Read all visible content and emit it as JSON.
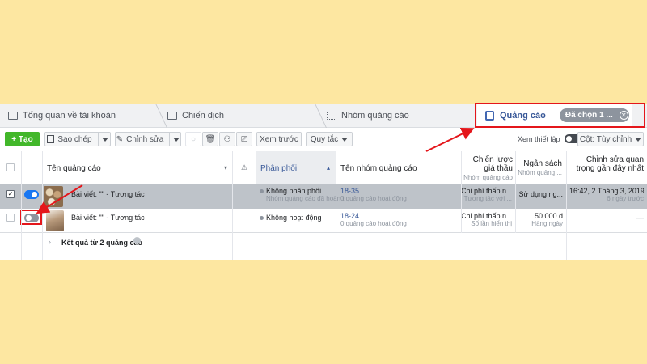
{
  "tabs": {
    "overview": "Tổng quan về tài khoản",
    "campaigns": "Chiến dịch",
    "adsets": "Nhóm quảng cáo",
    "ads": "Quảng cáo",
    "selected_pill": "Đã chọn 1 ...",
    "pill_close": "✕"
  },
  "toolbar": {
    "create": "+ Tạo",
    "copy": "Sao chép",
    "edit": "Chỉnh sửa",
    "preview": "Xem trước",
    "rules": "Quy tắc",
    "view_setup": "Xem thiết lập",
    "columns": "Cột: Tùy chỉnh"
  },
  "headers": {
    "ad_name": "Tên quảng cáo",
    "delivery": "Phân phối",
    "adset_name": "Tên nhóm quảng cáo",
    "bid_strategy": "Chiến lược giá thầu",
    "bid_strategy_sub": "Nhóm quảng cáo",
    "budget": "Ngân sách",
    "budget_sub": "Nhóm quảng ...",
    "last_edit": "Chỉnh sửa quan trọng gần đây nhất"
  },
  "rows": [
    {
      "name": "Bài viết: \"\" - Tương tác",
      "delivery": "Không phân phối",
      "delivery_sub": "Nhóm quảng cáo đã hoàn t",
      "adset": "18-35",
      "adset_sub": "0 quảng cáo hoạt động",
      "bid": "Chi phí thấp n...",
      "bid_sub": "Tương tác với ...",
      "budget": "Sử dụng ng...",
      "budget_sub": "",
      "edited": "16:42, 2 Tháng 3, 2019",
      "edited_sub": "6 ngày trước"
    },
    {
      "name": "Bài viết: \"\" - Tương tác",
      "delivery": "Không hoạt động",
      "delivery_sub": "",
      "adset": "18-24",
      "adset_sub": "0 quảng cáo hoạt động",
      "bid": "Chi phí thấp n...",
      "bid_sub": "Số lần hiển thị",
      "budget": "50.000 đ",
      "budget_sub": "Hàng ngày",
      "edited": "—",
      "edited_sub": ""
    }
  ],
  "summary": "Kết quả từ 2 quảng cáo",
  "colors": {
    "accent": "#1877f2",
    "highlight": "#e4161b",
    "create": "#42b72a",
    "background": "#fde7a1"
  }
}
